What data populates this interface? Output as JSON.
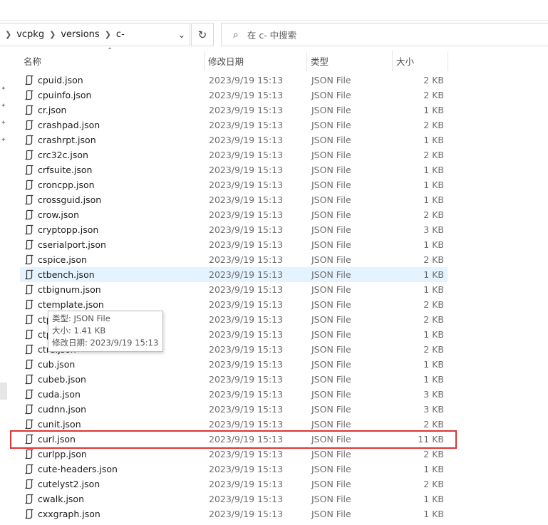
{
  "breadcrumb": [
    "vcpkg",
    "versions",
    "c-"
  ],
  "search": {
    "placeholder": "在 c- 中搜索"
  },
  "columns": {
    "name": "名称",
    "date": "修改日期",
    "type": "类型",
    "size": "大小"
  },
  "files": [
    {
      "name": "cpuid.json",
      "date": "2023/9/19 15:13",
      "type": "JSON File",
      "size": "2 KB"
    },
    {
      "name": "cpuinfo.json",
      "date": "2023/9/19 15:13",
      "type": "JSON File",
      "size": "2 KB"
    },
    {
      "name": "cr.json",
      "date": "2023/9/19 15:13",
      "type": "JSON File",
      "size": "1 KB"
    },
    {
      "name": "crashpad.json",
      "date": "2023/9/19 15:13",
      "type": "JSON File",
      "size": "2 KB"
    },
    {
      "name": "crashrpt.json",
      "date": "2023/9/19 15:13",
      "type": "JSON File",
      "size": "1 KB"
    },
    {
      "name": "crc32c.json",
      "date": "2023/9/19 15:13",
      "type": "JSON File",
      "size": "2 KB"
    },
    {
      "name": "crfsuite.json",
      "date": "2023/9/19 15:13",
      "type": "JSON File",
      "size": "1 KB"
    },
    {
      "name": "croncpp.json",
      "date": "2023/9/19 15:13",
      "type": "JSON File",
      "size": "1 KB"
    },
    {
      "name": "crossguid.json",
      "date": "2023/9/19 15:13",
      "type": "JSON File",
      "size": "1 KB"
    },
    {
      "name": "crow.json",
      "date": "2023/9/19 15:13",
      "type": "JSON File",
      "size": "2 KB"
    },
    {
      "name": "cryptopp.json",
      "date": "2023/9/19 15:13",
      "type": "JSON File",
      "size": "3 KB"
    },
    {
      "name": "cserialport.json",
      "date": "2023/9/19 15:13",
      "type": "JSON File",
      "size": "1 KB"
    },
    {
      "name": "cspice.json",
      "date": "2023/9/19 15:13",
      "type": "JSON File",
      "size": "2 KB"
    },
    {
      "name": "ctbench.json",
      "date": "2023/9/19 15:13",
      "type": "JSON File",
      "size": "1 KB"
    },
    {
      "name": "ctbignum.json",
      "date": "2023/9/19 15:13",
      "type": "JSON File",
      "size": "1 KB"
    },
    {
      "name": "ctemplate.json",
      "date": "2023/9/19 15:13",
      "type": "JSON File",
      "size": "2 KB"
    },
    {
      "name": "ctp",
      "date": "2023/9/19 15:13",
      "type": "JSON File",
      "size": "2 KB"
    },
    {
      "name": "ctp",
      "date": "2023/9/19 15:13",
      "type": "JSON File",
      "size": "1 KB"
    },
    {
      "name": "ctre.json",
      "date": "2023/9/19 15:13",
      "type": "JSON File",
      "size": "2 KB"
    },
    {
      "name": "cub.json",
      "date": "2023/9/19 15:13",
      "type": "JSON File",
      "size": "1 KB"
    },
    {
      "name": "cubeb.json",
      "date": "2023/9/19 15:13",
      "type": "JSON File",
      "size": "1 KB"
    },
    {
      "name": "cuda.json",
      "date": "2023/9/19 15:13",
      "type": "JSON File",
      "size": "3 KB"
    },
    {
      "name": "cudnn.json",
      "date": "2023/9/19 15:13",
      "type": "JSON File",
      "size": "3 KB"
    },
    {
      "name": "cunit.json",
      "date": "2023/9/19 15:13",
      "type": "JSON File",
      "size": "2 KB"
    },
    {
      "name": "curl.json",
      "date": "2023/9/19 15:13",
      "type": "JSON File",
      "size": "11 KB"
    },
    {
      "name": "curlpp.json",
      "date": "2023/9/19 15:13",
      "type": "JSON File",
      "size": "2 KB"
    },
    {
      "name": "cute-headers.json",
      "date": "2023/9/19 15:13",
      "type": "JSON File",
      "size": "1 KB"
    },
    {
      "name": "cutelyst2.json",
      "date": "2023/9/19 15:13",
      "type": "JSON File",
      "size": "2 KB"
    },
    {
      "name": "cwalk.json",
      "date": "2023/9/19 15:13",
      "type": "JSON File",
      "size": "1 KB"
    },
    {
      "name": "cxxgraph.json",
      "date": "2023/9/19 15:13",
      "type": "JSON File",
      "size": "1 KB"
    }
  ],
  "tooltip": {
    "type_line": "类型: JSON File",
    "size_line": "大小: 1.41 KB",
    "date_line": "修改日期: 2023/9/19 15:13"
  },
  "colors": {
    "highlight": "#e03434",
    "hover_row": "#e5f3ff"
  }
}
